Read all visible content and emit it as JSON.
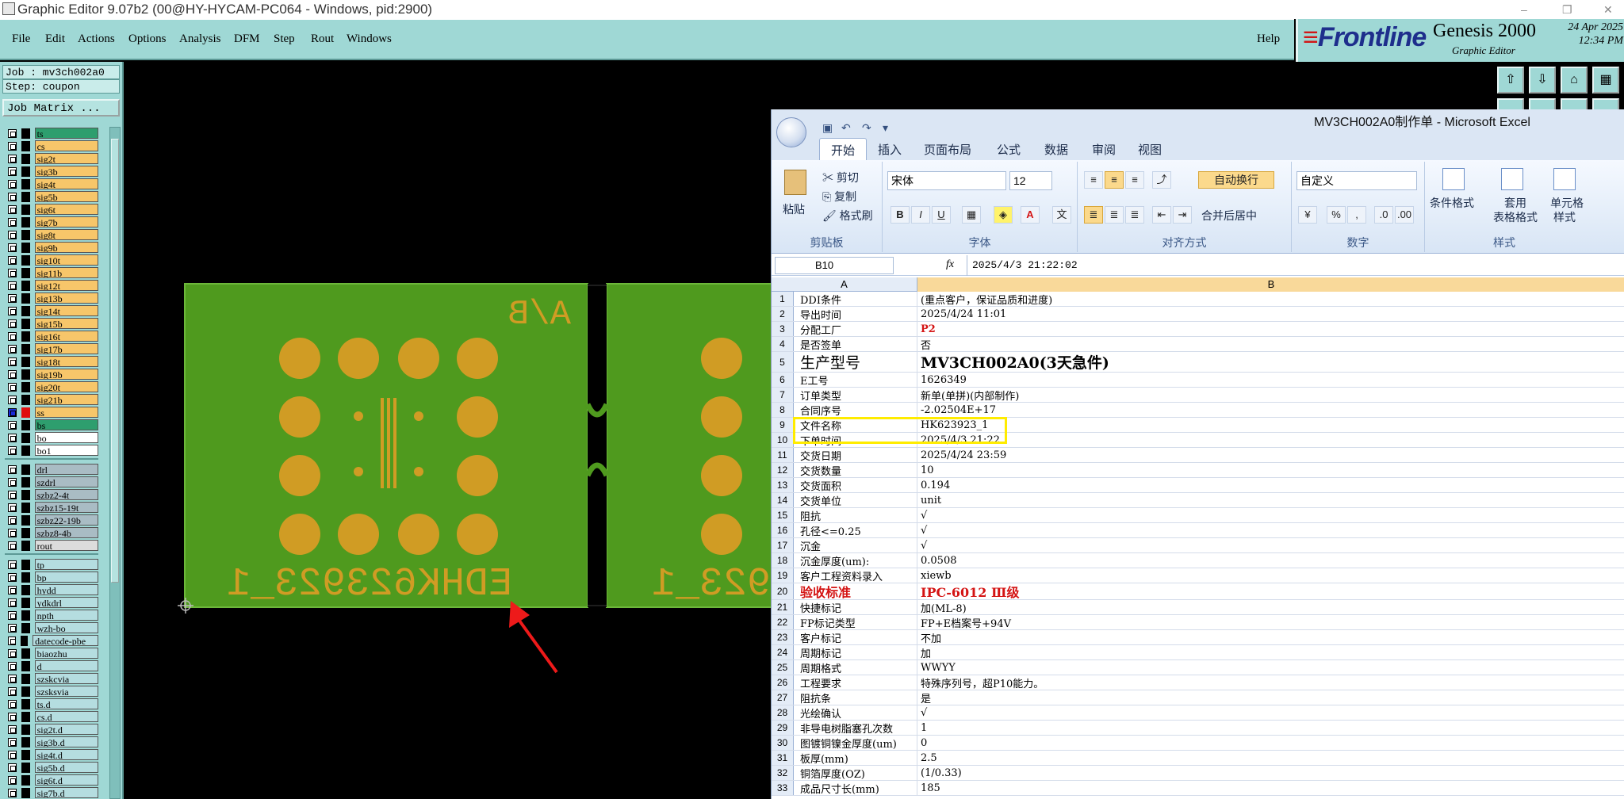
{
  "app": {
    "title": "Graphic Editor 9.07b2 (00@HY-HYCAM-PC064 - Windows, pid:2900)",
    "window_controls": [
      "–",
      "❐",
      "✕"
    ]
  },
  "menu": {
    "items": [
      "File",
      "Edit",
      "Actions",
      "Options",
      "Analysis",
      "DFM",
      "Step",
      "Rout",
      "Windows"
    ],
    "help": "Help"
  },
  "brand": {
    "logo": "Frontline",
    "product": "Genesis 2000",
    "subtitle": "Graphic Editor",
    "date": "24 Apr 2025",
    "time": "12:34 PM"
  },
  "left_panel": {
    "job": "Job : mv3ch002a0",
    "step": "Step: coupon",
    "job_matrix": "Job Matrix ..."
  },
  "layers": [
    {
      "name": "ts",
      "color": "#2e9e6e",
      "swatch": "#000000"
    },
    {
      "name": "cs",
      "color": "#f7c66a",
      "swatch": "#000000"
    },
    {
      "name": "sig2t",
      "color": "#f7c66a",
      "swatch": "#000000"
    },
    {
      "name": "sig3b",
      "color": "#f7c66a",
      "swatch": "#000000"
    },
    {
      "name": "sig4t",
      "color": "#f7c66a",
      "swatch": "#000000"
    },
    {
      "name": "sig5b",
      "color": "#f7c66a",
      "swatch": "#000000"
    },
    {
      "name": "sig6t",
      "color": "#f7c66a",
      "swatch": "#000000"
    },
    {
      "name": "sig7b",
      "color": "#f7c66a",
      "swatch": "#000000"
    },
    {
      "name": "sig8t",
      "color": "#f7c66a",
      "swatch": "#000000"
    },
    {
      "name": "sig9b",
      "color": "#f7c66a",
      "swatch": "#000000"
    },
    {
      "name": "sig10t",
      "color": "#f7c66a",
      "swatch": "#000000"
    },
    {
      "name": "sig11b",
      "color": "#f7c66a",
      "swatch": "#000000"
    },
    {
      "name": "sig12t",
      "color": "#f7c66a",
      "swatch": "#000000"
    },
    {
      "name": "sig13b",
      "color": "#f7c66a",
      "swatch": "#000000"
    },
    {
      "name": "sig14t",
      "color": "#f7c66a",
      "swatch": "#000000"
    },
    {
      "name": "sig15b",
      "color": "#f7c66a",
      "swatch": "#000000"
    },
    {
      "name": "sig16t",
      "color": "#f7c66a",
      "swatch": "#000000"
    },
    {
      "name": "sig17b",
      "color": "#f7c66a",
      "swatch": "#000000"
    },
    {
      "name": "sig18t",
      "color": "#f7c66a",
      "swatch": "#000000"
    },
    {
      "name": "sig19b",
      "color": "#f7c66a",
      "swatch": "#000000"
    },
    {
      "name": "sig20t",
      "color": "#f7c66a",
      "swatch": "#000000"
    },
    {
      "name": "sig21b",
      "color": "#f7c66a",
      "swatch": "#000000"
    },
    {
      "name": "ss",
      "color": "#f7c66a",
      "swatch": "#e01010",
      "active": true
    },
    {
      "name": "bs",
      "color": "#2e9e6e",
      "swatch": "#000000"
    },
    {
      "name": "bo",
      "color": "#ffffff",
      "swatch": "#000000"
    },
    {
      "name": "bo1",
      "color": "#ffffff",
      "swatch": "#000000",
      "group_end": true
    },
    {
      "name": "drl",
      "color": "#a9bcc4",
      "swatch": "#000000"
    },
    {
      "name": "szdrl",
      "color": "#a9bcc4",
      "swatch": "#000000"
    },
    {
      "name": "szbz2-4t",
      "color": "#a9bcc4",
      "swatch": "#000000"
    },
    {
      "name": "szbz15-19t",
      "color": "#a9bcc4",
      "swatch": "#000000"
    },
    {
      "name": "szbz22-19b",
      "color": "#a9bcc4",
      "swatch": "#000000"
    },
    {
      "name": "szbz8-4b",
      "color": "#a9bcc4",
      "swatch": "#000000"
    },
    {
      "name": "rout",
      "color": "#dcdcdc",
      "swatch": "#000000",
      "group_end": true
    },
    {
      "name": "tp",
      "color": "#b5dde0",
      "swatch": "#000000"
    },
    {
      "name": "bp",
      "color": "#b5dde0",
      "swatch": "#000000"
    },
    {
      "name": "hydd",
      "color": "#b5dde0",
      "swatch": "#000000"
    },
    {
      "name": "ydkdrl",
      "color": "#b5dde0",
      "swatch": "#000000"
    },
    {
      "name": "npth",
      "color": "#b5dde0",
      "swatch": "#000000"
    },
    {
      "name": "wzh-bo",
      "color": "#b5dde0",
      "swatch": "#000000"
    },
    {
      "name": "datecode-pbe",
      "color": "#b5dde0",
      "swatch": "#000000",
      "wide": true
    },
    {
      "name": "biaozhu",
      "color": "#b5dde0",
      "swatch": "#000000"
    },
    {
      "name": "d",
      "color": "#b5dde0",
      "swatch": "#000000"
    },
    {
      "name": "szskcvia",
      "color": "#b5dde0",
      "swatch": "#000000"
    },
    {
      "name": "szsksvia",
      "color": "#b5dde0",
      "swatch": "#000000"
    },
    {
      "name": "ts.d",
      "color": "#b5dde0",
      "swatch": "#000000"
    },
    {
      "name": "cs.d",
      "color": "#b5dde0",
      "swatch": "#000000"
    },
    {
      "name": "sig2t.d",
      "color": "#b5dde0",
      "swatch": "#000000"
    },
    {
      "name": "sig3b.d",
      "color": "#b5dde0",
      "swatch": "#000000"
    },
    {
      "name": "sig4t.d",
      "color": "#b5dde0",
      "swatch": "#000000"
    },
    {
      "name": "sig5b.d",
      "color": "#b5dde0",
      "swatch": "#000000"
    },
    {
      "name": "sig6t.d",
      "color": "#b5dde0",
      "swatch": "#000000"
    },
    {
      "name": "sig7b.d",
      "color": "#b5dde0",
      "swatch": "#000000"
    }
  ],
  "pcb": {
    "label_top": "A/B",
    "label_bottom": "EDHK623923_1",
    "label_bottom_2": "923_1",
    "board_color": "#4f9a1e",
    "pad_color": "#d09c24"
  },
  "excel": {
    "title": "MV3CH002A0制作单 - Microsoft Excel",
    "tabs": [
      "开始",
      "插入",
      "页面布局",
      "公式",
      "数据",
      "审阅",
      "视图"
    ],
    "ribbon": {
      "paste": "粘贴",
      "cut": "剪切",
      "copy": "复制",
      "format_painter": "格式刷",
      "clipboard": "剪贴板",
      "font_name": "宋体",
      "font_size": "12",
      "font_group": "字体",
      "wrap": "自动换行",
      "merge": "合并后居中",
      "align_group": "对齐方式",
      "number_format": "自定义",
      "number_group": "数字",
      "cond_format": "条件格式",
      "table_format_1": "套用",
      "table_format_2": "表格格式",
      "cell_style_1": "单元格",
      "cell_style_2": "样式",
      "styles_group": "样式"
    },
    "name_box": "B10",
    "formula": "2025/4/3  21:22:02",
    "columns": [
      "A",
      "B"
    ],
    "rows": [
      {
        "n": "1",
        "a": "DDI条件",
        "b": "(重点客户，保证品质和进度)"
      },
      {
        "n": "2",
        "a": "导出时间",
        "b": "2025/4/24 11:01"
      },
      {
        "n": "3",
        "a": "分配工厂",
        "b": "P2",
        "red": true
      },
      {
        "n": "4",
        "a": "是否签单",
        "b": "否"
      },
      {
        "n": "5",
        "a": "生产型号",
        "b": "MV3CH002A0(3天急件)",
        "big": true
      },
      {
        "n": "6",
        "a": "E工号",
        "b": "1626349"
      },
      {
        "n": "7",
        "a": "订单类型",
        "b": "新单(单拼)(内部制作)"
      },
      {
        "n": "8",
        "a": "合同序号",
        "b": "-2.02504E+17"
      },
      {
        "n": "9",
        "a": "文件名称",
        "b": "HK623923_1"
      },
      {
        "n": "10",
        "a": "下单时间",
        "b": "2025/4/3 21:22"
      },
      {
        "n": "11",
        "a": "交货日期",
        "b": "2025/4/24 23:59"
      },
      {
        "n": "12",
        "a": "交货数量",
        "b": "10"
      },
      {
        "n": "13",
        "a": "交货面积",
        "b": "0.194"
      },
      {
        "n": "14",
        "a": "交货单位",
        "b": "unit"
      },
      {
        "n": "15",
        "a": "阻抗",
        "b": "√"
      },
      {
        "n": "16",
        "a": "孔径<=0.25",
        "b": "√"
      },
      {
        "n": "17",
        "a": "沉金",
        "b": "√"
      },
      {
        "n": "18",
        "a": "沉金厚度(um):",
        "b": "0.0508"
      },
      {
        "n": "19",
        "a": "客户工程资料录入",
        "b": "xiewb"
      },
      {
        "n": "20",
        "a": "验收标准",
        "b": "IPC-6012 Ⅲ级",
        "red_both": true
      },
      {
        "n": "21",
        "a": "快捷标记",
        "b": "加(ML-8)"
      },
      {
        "n": "22",
        "a": "FP标记类型",
        "b": "FP+E档案号+94V"
      },
      {
        "n": "23",
        "a": "客户标记",
        "b": "不加"
      },
      {
        "n": "24",
        "a": "周期标记",
        "b": "加"
      },
      {
        "n": "25",
        "a": "周期格式",
        "b": "WWYY"
      },
      {
        "n": "26",
        "a": "工程要求",
        "b": "特殊序列号，超P10能力。"
      },
      {
        "n": "27",
        "a": "阻抗条",
        "b": "是"
      },
      {
        "n": "28",
        "a": "光绘确认",
        "b": "√"
      },
      {
        "n": "29",
        "a": "非导电树脂塞孔次数",
        "b": "1"
      },
      {
        "n": "30",
        "a": "图镀铜镍金厚度(um)",
        "b": "0"
      },
      {
        "n": "31",
        "a": "板厚(mm)",
        "b": "2.5"
      },
      {
        "n": "32",
        "a": "铜箔厚度(OZ)",
        "b": " (1/0.33)"
      },
      {
        "n": "33",
        "a": "成品尺寸长(mm)",
        "b": "185"
      }
    ]
  }
}
